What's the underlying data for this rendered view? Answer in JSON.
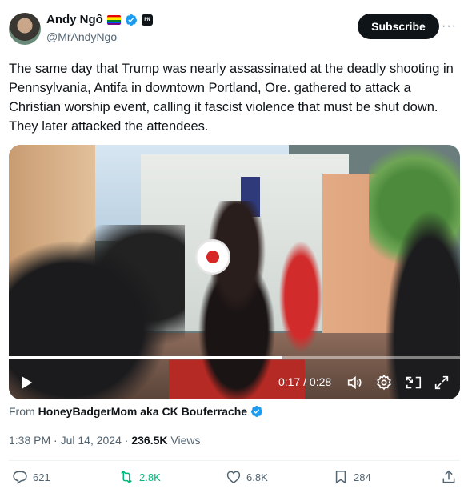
{
  "author": {
    "name": "Andy Ngô",
    "handle": "@MrAndyNgo",
    "affiliate_badge_text": "PN"
  },
  "subscribe_label": "Subscribe",
  "more_label": "···",
  "tweet_text": "The same day that Trump was nearly assassinated at the deadly shooting in Pennsylvania, Antifa in downtown Portland, Ore. gathered to attack a Christian worship event, calling it fascist violence that must be shut down. They later attacked the attendees.",
  "video": {
    "elapsed_time": "0:17",
    "total_time": "0:28",
    "time_display": "0:17 / 0:28",
    "progress_fraction": 0.607
  },
  "source": {
    "prefix": "From",
    "account_name": "HoneyBadgerMom aka CK Bouferrache"
  },
  "meta": {
    "time": "1:38 PM",
    "separator": "·",
    "date": "Jul 14, 2024",
    "views_count": "236.5K",
    "views_label": "Views"
  },
  "actions": {
    "replies": "621",
    "reposts": "2.8K",
    "likes": "6.8K",
    "bookmarks": "284"
  },
  "colors": {
    "text": "#0f1419",
    "secondary": "#536471",
    "verified_blue": "#1d9bf0",
    "repost_green": "#00ba7c",
    "divider": "#eff3f4"
  }
}
